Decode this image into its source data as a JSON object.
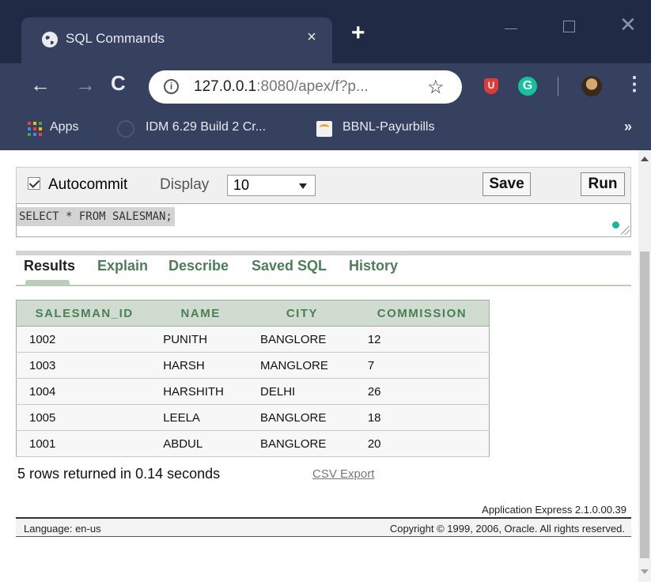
{
  "browser": {
    "tab_title": "SQL Commands",
    "tab_close": "×",
    "new_tab": "+",
    "url_host": "127.0.0.1",
    "url_rest": ":8080/apex/f?p...",
    "info_glyph": "i",
    "extension_shield": "U",
    "extension_grammarly": "G",
    "bookmarks": [
      {
        "label": "Apps"
      },
      {
        "label": "IDM 6.29 Build 2 Cr..."
      },
      {
        "label": "BBNL-Payurbills"
      }
    ],
    "more_bookmarks": "»",
    "colors": {
      "frame": "#202a44",
      "toolbar": "#35415f"
    }
  },
  "command": {
    "autocommit_label": "Autocommit",
    "display_label": "Display",
    "display_value": "10",
    "save_label": "Save",
    "run_label": "Run",
    "sql_text": "SELECT * FROM SALESMAN;"
  },
  "tabs": [
    {
      "label": "Results"
    },
    {
      "label": "Explain"
    },
    {
      "label": "Describe"
    },
    {
      "label": "Saved SQL"
    },
    {
      "label": "History"
    }
  ],
  "results": {
    "columns": [
      "SALESMAN_ID",
      "NAME",
      "CITY",
      "COMMISSION"
    ],
    "rows": [
      [
        "1002",
        "PUNITH",
        "BANGLORE",
        "12"
      ],
      [
        "1003",
        "HARSH",
        "MANGLORE",
        "7"
      ],
      [
        "1004",
        "HARSHITH",
        "DELHI",
        "26"
      ],
      [
        "1005",
        "LEELA",
        "BANGLORE",
        "18"
      ],
      [
        "1001",
        "ABDUL",
        "BANGLORE",
        "20"
      ]
    ],
    "summary": "5 rows returned in 0.14 seconds",
    "csv_export": "CSV Export"
  },
  "footer": {
    "app_version": "Application Express 2.1.0.00.39",
    "language": "Language: en-us",
    "copyright": "Copyright © 1999, 2006, Oracle. All rights reserved."
  },
  "colors": {
    "accent_green": "#4d7f57",
    "header_bg": "#cfdccf"
  }
}
